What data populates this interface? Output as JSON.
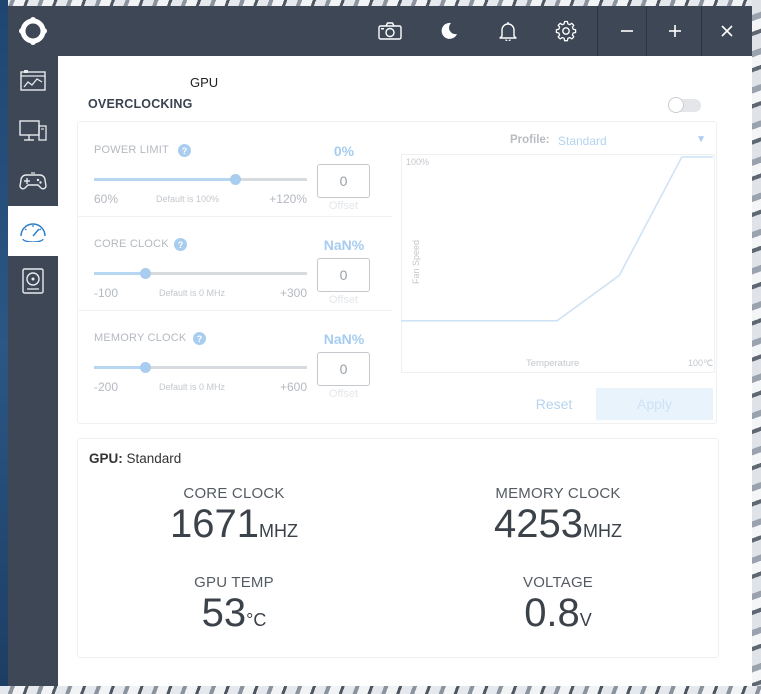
{
  "titlebar": {
    "buttons": [
      {
        "name": "screenshot",
        "icon": "camera-icon"
      },
      {
        "name": "night-mode",
        "icon": "moon-icon"
      },
      {
        "name": "notifications",
        "icon": "bell-icon"
      },
      {
        "name": "settings",
        "icon": "gear-icon"
      },
      {
        "name": "minimize",
        "icon": "minus-icon"
      },
      {
        "name": "maximize",
        "icon": "plus-icon"
      },
      {
        "name": "close",
        "icon": "close-icon"
      }
    ]
  },
  "sidebar": {
    "items": [
      {
        "name": "dashboard",
        "icon": "dashboard-icon",
        "active": false
      },
      {
        "name": "display",
        "icon": "monitor-icon",
        "active": false
      },
      {
        "name": "gaming",
        "icon": "gamepad-icon",
        "active": false
      },
      {
        "name": "overclocking",
        "icon": "speedometer-icon",
        "active": true
      },
      {
        "name": "storage",
        "icon": "disk-icon",
        "active": false
      }
    ]
  },
  "page": {
    "title": "GPU",
    "section": "OVERCLOCKING",
    "toggle_on": false
  },
  "overclock": {
    "rows": [
      {
        "label": "POWER LIMIT",
        "min": "60%",
        "max": "+120%",
        "default_text": "Default is 100%",
        "pct": "0%",
        "value": "0",
        "offset_label": "Offset",
        "level": 0.66
      },
      {
        "label": "CORE CLOCK",
        "min": "-100",
        "max": "+300",
        "default_text": "Default is 0 MHz",
        "pct": "NaN%",
        "value": "0",
        "offset_label": "Offset",
        "level": 0.24
      },
      {
        "label": "MEMORY CLOCK",
        "min": "-200",
        "max": "+600",
        "default_text": "Default is 0 MHz",
        "pct": "NaN%",
        "value": "0",
        "offset_label": "Offset",
        "level": 0.24
      }
    ],
    "help_glyph": "?",
    "profile_label": "Profile:",
    "profile_value": "Standard",
    "profile_caret": "▼",
    "reset_label": "Reset",
    "apply_label": "Apply"
  },
  "chart_data": {
    "type": "line",
    "title": "",
    "xlabel": "Temperature",
    "ylabel": "Fan Speed",
    "y_top_label": "100%",
    "x_end_label": "100℃",
    "xlim": [
      0,
      100
    ],
    "ylim": [
      0,
      100
    ],
    "series": [
      {
        "x": [
          0,
          50,
          70,
          90,
          100
        ],
        "y": [
          10,
          10,
          35,
          100,
          100
        ]
      }
    ]
  },
  "gpu": {
    "label": "GPU:",
    "profile": "Standard",
    "stats": [
      {
        "title": "CORE CLOCK",
        "value": "1671",
        "unit": "MHZ"
      },
      {
        "title": "MEMORY CLOCK",
        "value": "4253",
        "unit": "MHZ"
      },
      {
        "title": "GPU TEMP",
        "value": "53",
        "unit": "°C"
      },
      {
        "title": "VOLTAGE",
        "value": "0.8",
        "unit": "V"
      }
    ]
  },
  "colors": {
    "titlebar": "#3d4756",
    "accent": "#a9cdee"
  }
}
